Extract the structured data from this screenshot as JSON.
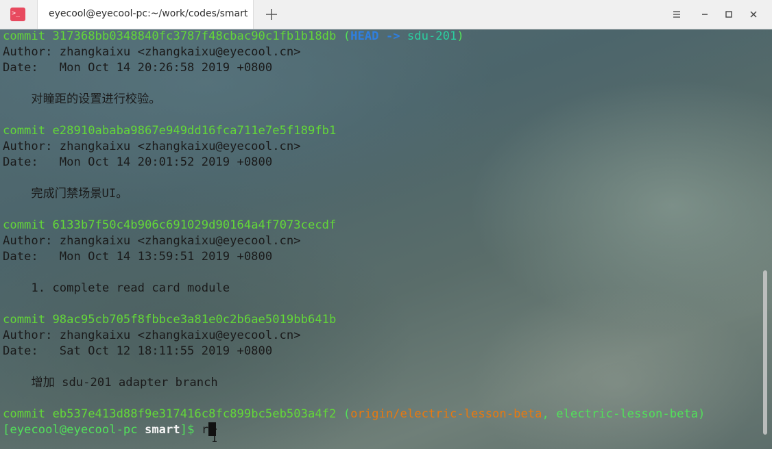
{
  "window": {
    "tab_title": "eyecool@eyecool-pc:~/work/codes/smart",
    "app_icon_glyph": ">_",
    "accent_color": "#e84a5f"
  },
  "icons": {
    "app": "terminal-icon",
    "new_tab": "plus-icon",
    "menu": "hamburger-menu-icon",
    "minimize": "minimize-icon",
    "maximize": "maximize-icon",
    "close": "close-icon"
  },
  "log": [
    {
      "commit_label": "commit",
      "hash": "317368bb0348840fc3787f48cbac90c1fb1b18db",
      "refs": {
        "open": "(",
        "head": "HEAD",
        "arrow": " -> ",
        "branch": "sdu-201",
        "close": ")"
      },
      "author": "Author: zhangkaixu <zhangkaixu@eyecool.cn>",
      "date": "Date:   Mon Oct 14 20:26:58 2019 +0800",
      "message": "    对瞳距的设置进行校验。"
    },
    {
      "commit_label": "commit",
      "hash": "e28910ababa9867e949dd16fca711e7e5f189fb1",
      "author": "Author: zhangkaixu <zhangkaixu@eyecool.cn>",
      "date": "Date:   Mon Oct 14 20:01:52 2019 +0800",
      "message": "    完成门禁场景UI。"
    },
    {
      "commit_label": "commit",
      "hash": "6133b7f50c4b906c691029d90164a4f7073cecdf",
      "author": "Author: zhangkaixu <zhangkaixu@eyecool.cn>",
      "date": "Date:   Mon Oct 14 13:59:51 2019 +0800",
      "message": "    1. complete read card module"
    },
    {
      "commit_label": "commit",
      "hash": "98ac95cb705f8fbbce3a81e0c2b6ae5019bb641b",
      "author": "Author: zhangkaixu <zhangkaixu@eyecool.cn>",
      "date": "Date:   Sat Oct 12 18:11:55 2019 +0800",
      "message": "    增加 sdu-201 adapter branch"
    },
    {
      "commit_label": "commit",
      "hash": "eb537e413d88f9e317416c8fc899bc5eb503a4f2",
      "refs": {
        "open": "(",
        "remote": "origin/electric-lesson-beta",
        "sep": ", ",
        "branch": "electric-lesson-beta",
        "close": ")"
      }
    }
  ],
  "prompt": {
    "open": "[",
    "user_host": "eyecool@eyecool-pc",
    "dir": "smart",
    "close": "]$",
    "typed": " r"
  },
  "colors": {
    "hash": "#63d838",
    "head": "#2f7fe0",
    "branch": "#2bd0a0",
    "remote": "#e8790f",
    "prompt": "#52e05a"
  }
}
